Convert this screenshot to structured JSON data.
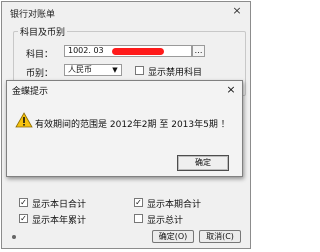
{
  "window": {
    "title": "银行对账单",
    "close_glyph": "×"
  },
  "group": {
    "title": "科目及币别"
  },
  "subject": {
    "label": "科目：",
    "value": "1002. 03",
    "browse_glyph": "…"
  },
  "currency": {
    "label": "币别：",
    "value": "人民币",
    "arrow_glyph": "▼"
  },
  "show_disabled": {
    "label": "显示禁用科目",
    "checked": false
  },
  "options": [
    {
      "label": "显示本日合计",
      "checked": true
    },
    {
      "label": "显示本期合计",
      "checked": true
    },
    {
      "label": "显示本年累计",
      "checked": true
    },
    {
      "label": "显示总计",
      "checked": false
    }
  ],
  "checkmark": "✓",
  "buttons": {
    "ok": "确定(O)",
    "cancel": "取消(C)"
  },
  "popup": {
    "title": "金蝶提示",
    "close_glyph": "×",
    "message": "有效期间的范围是 2012年2期 至 2013年5期 ！",
    "ok": "确定",
    "icon": "warning-icon"
  },
  "colors": {
    "redaction": "#ff1a1a",
    "warning": "#f6c20e"
  }
}
